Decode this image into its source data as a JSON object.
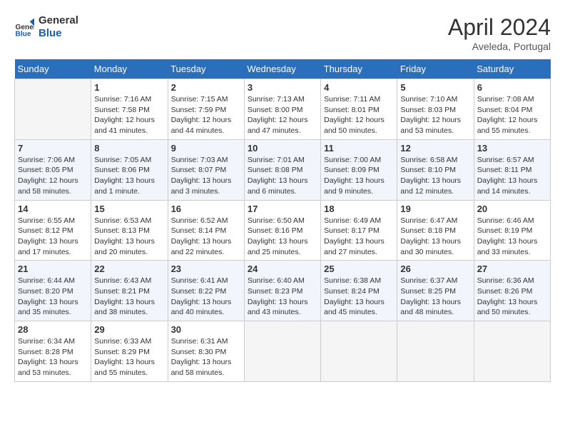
{
  "header": {
    "logo_line1": "General",
    "logo_line2": "Blue",
    "month": "April 2024",
    "location": "Aveleda, Portugal"
  },
  "days_of_week": [
    "Sunday",
    "Monday",
    "Tuesday",
    "Wednesday",
    "Thursday",
    "Friday",
    "Saturday"
  ],
  "weeks": [
    [
      {
        "day": "",
        "info": ""
      },
      {
        "day": "1",
        "info": "Sunrise: 7:16 AM\nSunset: 7:58 PM\nDaylight: 12 hours\nand 41 minutes."
      },
      {
        "day": "2",
        "info": "Sunrise: 7:15 AM\nSunset: 7:59 PM\nDaylight: 12 hours\nand 44 minutes."
      },
      {
        "day": "3",
        "info": "Sunrise: 7:13 AM\nSunset: 8:00 PM\nDaylight: 12 hours\nand 47 minutes."
      },
      {
        "day": "4",
        "info": "Sunrise: 7:11 AM\nSunset: 8:01 PM\nDaylight: 12 hours\nand 50 minutes."
      },
      {
        "day": "5",
        "info": "Sunrise: 7:10 AM\nSunset: 8:03 PM\nDaylight: 12 hours\nand 53 minutes."
      },
      {
        "day": "6",
        "info": "Sunrise: 7:08 AM\nSunset: 8:04 PM\nDaylight: 12 hours\nand 55 minutes."
      }
    ],
    [
      {
        "day": "7",
        "info": "Sunrise: 7:06 AM\nSunset: 8:05 PM\nDaylight: 12 hours\nand 58 minutes."
      },
      {
        "day": "8",
        "info": "Sunrise: 7:05 AM\nSunset: 8:06 PM\nDaylight: 13 hours\nand 1 minute."
      },
      {
        "day": "9",
        "info": "Sunrise: 7:03 AM\nSunset: 8:07 PM\nDaylight: 13 hours\nand 3 minutes."
      },
      {
        "day": "10",
        "info": "Sunrise: 7:01 AM\nSunset: 8:08 PM\nDaylight: 13 hours\nand 6 minutes."
      },
      {
        "day": "11",
        "info": "Sunrise: 7:00 AM\nSunset: 8:09 PM\nDaylight: 13 hours\nand 9 minutes."
      },
      {
        "day": "12",
        "info": "Sunrise: 6:58 AM\nSunset: 8:10 PM\nDaylight: 13 hours\nand 12 minutes."
      },
      {
        "day": "13",
        "info": "Sunrise: 6:57 AM\nSunset: 8:11 PM\nDaylight: 13 hours\nand 14 minutes."
      }
    ],
    [
      {
        "day": "14",
        "info": "Sunrise: 6:55 AM\nSunset: 8:12 PM\nDaylight: 13 hours\nand 17 minutes."
      },
      {
        "day": "15",
        "info": "Sunrise: 6:53 AM\nSunset: 8:13 PM\nDaylight: 13 hours\nand 20 minutes."
      },
      {
        "day": "16",
        "info": "Sunrise: 6:52 AM\nSunset: 8:14 PM\nDaylight: 13 hours\nand 22 minutes."
      },
      {
        "day": "17",
        "info": "Sunrise: 6:50 AM\nSunset: 8:16 PM\nDaylight: 13 hours\nand 25 minutes."
      },
      {
        "day": "18",
        "info": "Sunrise: 6:49 AM\nSunset: 8:17 PM\nDaylight: 13 hours\nand 27 minutes."
      },
      {
        "day": "19",
        "info": "Sunrise: 6:47 AM\nSunset: 8:18 PM\nDaylight: 13 hours\nand 30 minutes."
      },
      {
        "day": "20",
        "info": "Sunrise: 6:46 AM\nSunset: 8:19 PM\nDaylight: 13 hours\nand 33 minutes."
      }
    ],
    [
      {
        "day": "21",
        "info": "Sunrise: 6:44 AM\nSunset: 8:20 PM\nDaylight: 13 hours\nand 35 minutes."
      },
      {
        "day": "22",
        "info": "Sunrise: 6:43 AM\nSunset: 8:21 PM\nDaylight: 13 hours\nand 38 minutes."
      },
      {
        "day": "23",
        "info": "Sunrise: 6:41 AM\nSunset: 8:22 PM\nDaylight: 13 hours\nand 40 minutes."
      },
      {
        "day": "24",
        "info": "Sunrise: 6:40 AM\nSunset: 8:23 PM\nDaylight: 13 hours\nand 43 minutes."
      },
      {
        "day": "25",
        "info": "Sunrise: 6:38 AM\nSunset: 8:24 PM\nDaylight: 13 hours\nand 45 minutes."
      },
      {
        "day": "26",
        "info": "Sunrise: 6:37 AM\nSunset: 8:25 PM\nDaylight: 13 hours\nand 48 minutes."
      },
      {
        "day": "27",
        "info": "Sunrise: 6:36 AM\nSunset: 8:26 PM\nDaylight: 13 hours\nand 50 minutes."
      }
    ],
    [
      {
        "day": "28",
        "info": "Sunrise: 6:34 AM\nSunset: 8:28 PM\nDaylight: 13 hours\nand 53 minutes."
      },
      {
        "day": "29",
        "info": "Sunrise: 6:33 AM\nSunset: 8:29 PM\nDaylight: 13 hours\nand 55 minutes."
      },
      {
        "day": "30",
        "info": "Sunrise: 6:31 AM\nSunset: 8:30 PM\nDaylight: 13 hours\nand 58 minutes."
      },
      {
        "day": "",
        "info": ""
      },
      {
        "day": "",
        "info": ""
      },
      {
        "day": "",
        "info": ""
      },
      {
        "day": "",
        "info": ""
      }
    ]
  ]
}
